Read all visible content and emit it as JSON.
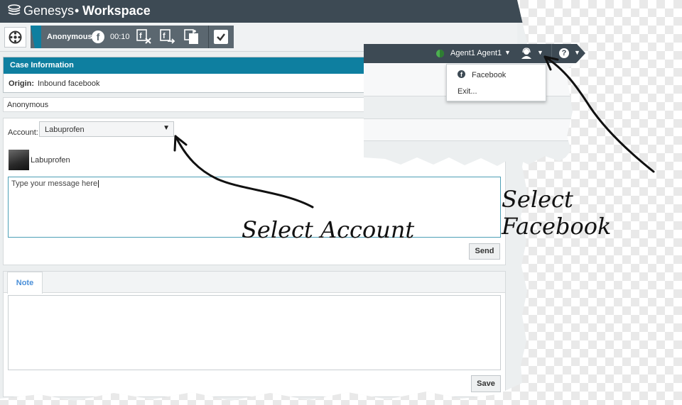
{
  "app": {
    "brand": "Genesys",
    "separator": "•",
    "name": "Workspace"
  },
  "interaction": {
    "contact": "Anonymous",
    "timer": "00:10",
    "channel_icon": "facebook-icon"
  },
  "toolbar": {
    "actions": [
      "facebook-end-icon",
      "facebook-transfer-icon",
      "facebook-conference-icon",
      "mark-done-icon"
    ]
  },
  "case": {
    "header": "Case Information",
    "origin_label": "Origin:",
    "origin_value": "Inbound facebook"
  },
  "contact_row": {
    "name": "Anonymous"
  },
  "compose": {
    "account_label": "Account:",
    "account_value": "Labuprofen",
    "profile_name": "Labuprofen",
    "message_placeholder": "Type your message here",
    "send_label": "Send"
  },
  "note": {
    "tab_label": "Note",
    "save_label": "Save"
  },
  "inset": {
    "agent_name": "Agent1 Agent1",
    "status_color": "#4caf50",
    "menu_items": [
      "Facebook",
      "Exit..."
    ]
  },
  "annotations": {
    "select_account": "Select Account",
    "select_facebook": "Select Facebook"
  },
  "colors": {
    "header_bg": "#3d4a54",
    "accent": "#0e7fa0",
    "tab_text": "#4a8fd8"
  }
}
